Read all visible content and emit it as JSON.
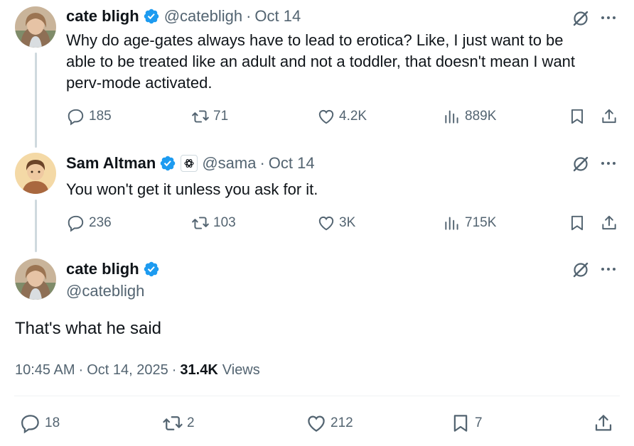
{
  "colors": {
    "verified": "#1d9bf0",
    "text": "#0f1419",
    "muted": "#536471",
    "thread_line": "#cfd9de"
  },
  "tweets": [
    {
      "name": "cate bligh",
      "handle": "@catebligh",
      "sep": "·",
      "date": "Oct 14",
      "lines": [
        "Why do age-gates always have to lead to erotica? Like, I just want to be",
        "able to be treated like an adult and not a toddler, that doesn't mean I want",
        "perv-mode activated."
      ],
      "replies": "185",
      "retweets": "71",
      "likes": "4.2K",
      "views": "889K",
      "icons": [
        "reply-icon",
        "retweet-icon",
        "like-icon",
        "views-icon",
        "bookmark-icon",
        "share-icon",
        "grok-icon",
        "more-icon"
      ]
    },
    {
      "name": "Sam Altman",
      "handle": "@sama",
      "sep": "·",
      "date": "Oct 14",
      "lines": [
        "You won't get it unless you ask for it."
      ],
      "replies": "236",
      "retweets": "103",
      "likes": "3K",
      "views": "715K",
      "icons": [
        "reply-icon",
        "retweet-icon",
        "like-icon",
        "views-icon",
        "bookmark-icon",
        "share-icon",
        "openai-affiliate-icon"
      ]
    }
  ],
  "main": {
    "name": "cate bligh",
    "handle": "@catebligh",
    "text": "That's what he said",
    "time": "10:45 AM",
    "sep1": "·",
    "date": "Oct 14, 2025",
    "sep2": "·",
    "views_count": "31.4K",
    "views_label": "Views",
    "replies": "18",
    "retweets": "2",
    "likes": "212",
    "bookmarks": "7"
  }
}
